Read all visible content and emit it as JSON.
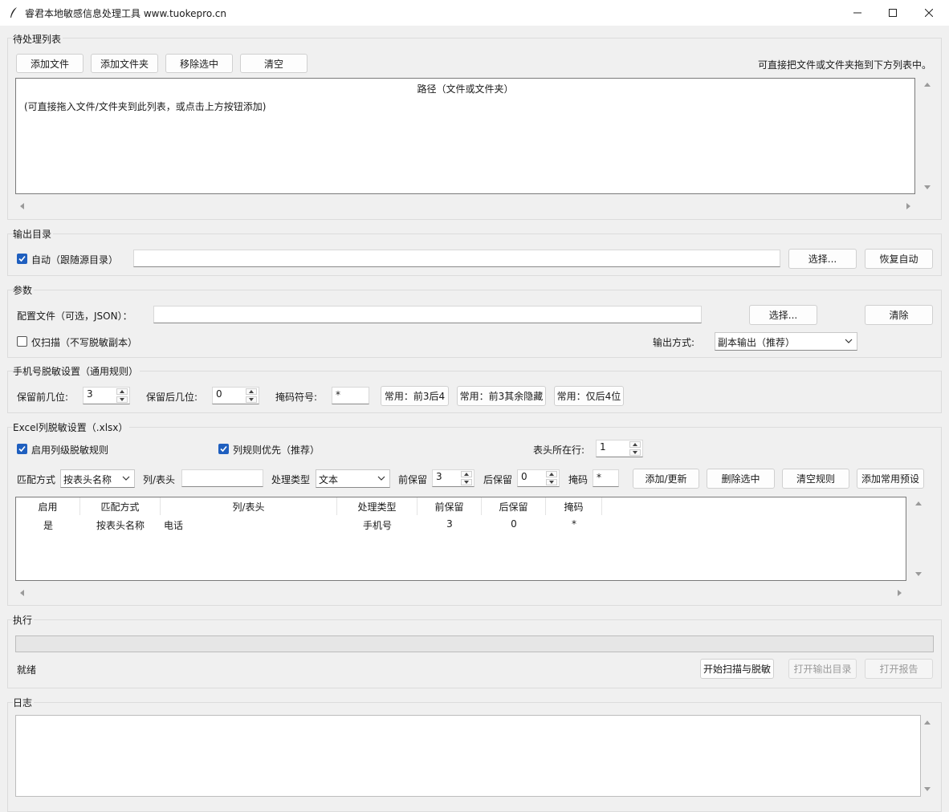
{
  "window": {
    "title": "睿君本地敏感信息处理工具  www.tuokepro.cn",
    "icon": "feather-pen-icon"
  },
  "pending": {
    "group_label": "待处理列表",
    "buttons": {
      "add_file": "添加文件",
      "add_folder": "添加文件夹",
      "remove_selected": "移除选中",
      "clear": "清空"
    },
    "hint": "可直接把文件或文件夹拖到下方列表中。",
    "column_header": "路径（文件或文件夹）",
    "placeholder_row": "(可直接拖入文件/文件夹到此列表，或点击上方按钮添加)"
  },
  "output": {
    "group_label": "输出目录",
    "auto_checked": true,
    "auto_label": "自动（跟随源目录）",
    "path_value": "",
    "choose_button": "选择...",
    "restore_button": "恢复自动"
  },
  "params": {
    "group_label": "参数",
    "config_label": "配置文件（可选，JSON）：",
    "config_value": "",
    "choose_button": "选择...",
    "clear_button": "清除",
    "scan_only_checked": false,
    "scan_only_label": "仅扫描（不写脱敏副本）",
    "output_mode_label": "输出方式:",
    "output_mode_value": "副本输出（推荐）"
  },
  "phone": {
    "group_label": "手机号脱敏设置（通用规则）",
    "keep_front_label": "保留前几位:",
    "keep_front_value": "3",
    "keep_back_label": "保留后几位:",
    "keep_back_value": "0",
    "mask_label": "掩码符号:",
    "mask_value": "*",
    "preset1": "常用：前3后4",
    "preset2": "常用：前3其余隐藏",
    "preset3": "常用：仅后4位"
  },
  "excel": {
    "group_label": "Excel列脱敏设置（.xlsx）",
    "enable_checked": true,
    "enable_label": "启用列级脱敏规则",
    "priority_checked": true,
    "priority_label": "列规则优先（推荐）",
    "header_row_label": "表头所在行:",
    "header_row_value": "1",
    "match_label": "匹配方式",
    "match_value": "按表头名称",
    "col_label": "列/表头",
    "col_value": "",
    "type_label": "处理类型",
    "type_value": "文本",
    "front_label": "前保留",
    "front_value": "3",
    "back_label": "后保留",
    "back_value": "0",
    "mask_label": "掩码",
    "mask_value": "*",
    "add_update_button": "添加/更新",
    "delete_button": "删除选中",
    "clear_rules_button": "清空规则",
    "add_preset_button": "添加常用预设",
    "table_headers": [
      "启用",
      "匹配方式",
      "列/表头",
      "处理类型",
      "前保留",
      "后保留",
      "掩码"
    ],
    "rows": [
      [
        "是",
        "按表头名称",
        "电话",
        "手机号",
        "3",
        "0",
        "*"
      ]
    ]
  },
  "execute": {
    "group_label": "执行",
    "progress": 0,
    "status": "就绪",
    "start_button": "开始扫描与脱敏",
    "open_output_button": "打开输出目录",
    "open_report_button": "打开报告"
  },
  "log": {
    "group_label": "日志",
    "content": ""
  }
}
